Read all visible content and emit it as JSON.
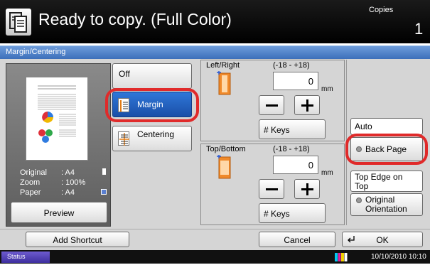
{
  "header": {
    "title": "Ready to copy. (Full Color)",
    "copies_label": "Copies",
    "copies_count": "1"
  },
  "panel": {
    "title": "Margin/Centering"
  },
  "preview": {
    "original_label": "Original",
    "original_value": ": A4",
    "zoom_label": "Zoom",
    "zoom_value": ": 100%",
    "paper_label": "Paper",
    "paper_value": ": A4",
    "preview_button": "Preview"
  },
  "modes": {
    "off": "Off",
    "margin": "Margin",
    "centering": "Centering",
    "selected": "Margin"
  },
  "left_right": {
    "label": "Left/Right",
    "range": "(-18 - +18)",
    "value": "0",
    "unit": "mm",
    "keys_button": "# Keys"
  },
  "top_bottom": {
    "label": "Top/Bottom",
    "range": "(-18 - +18)",
    "value": "0",
    "unit": "mm",
    "keys_button": "# Keys"
  },
  "back_page": {
    "auto": "Auto",
    "back_page": "Back Page"
  },
  "orientation": {
    "top_edge_on_top": "Top Edge on Top",
    "original_orientation": "Original Orientation"
  },
  "footer": {
    "add_shortcut": "Add Shortcut",
    "cancel": "Cancel",
    "ok": "OK"
  },
  "status_bar": {
    "status": "Status",
    "datetime": "10/10/2010  10:10"
  },
  "colors": {
    "accent_blue": "#1f5fc4",
    "highlight_red": "#e02a2a"
  }
}
